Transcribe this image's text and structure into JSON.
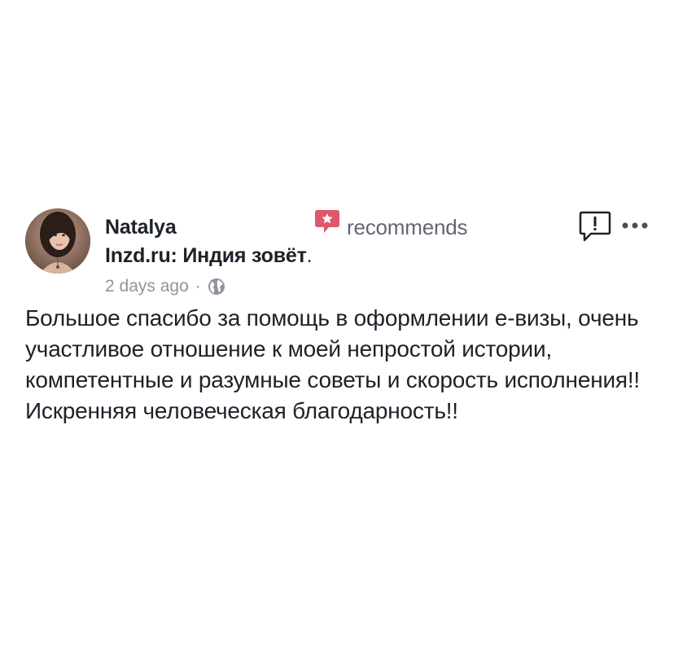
{
  "post": {
    "author": "Natalya",
    "action": "recommends",
    "page_name": "Inzd.ru: Индия зовёт",
    "page_suffix": ".",
    "timestamp": "2 days ago",
    "separator": "·",
    "privacy_icon": "globe-icon",
    "recommend_icon": "recommend-star-icon",
    "report_icon": "report-icon",
    "more_icon": "more-options-icon",
    "text": "Большое спасибо за помощь в оформлении е-визы, очень участливое отношение к моей непростой истории, компетентные и разумные советы и скорость исполнения!! Искренняя человеческая благодарность!!",
    "colors": {
      "recommend_accent": "#e0566b",
      "text_primary": "#1d2129",
      "text_secondary": "#616770",
      "text_meta": "#90949c",
      "icon_dark": "#4b4f56"
    }
  }
}
